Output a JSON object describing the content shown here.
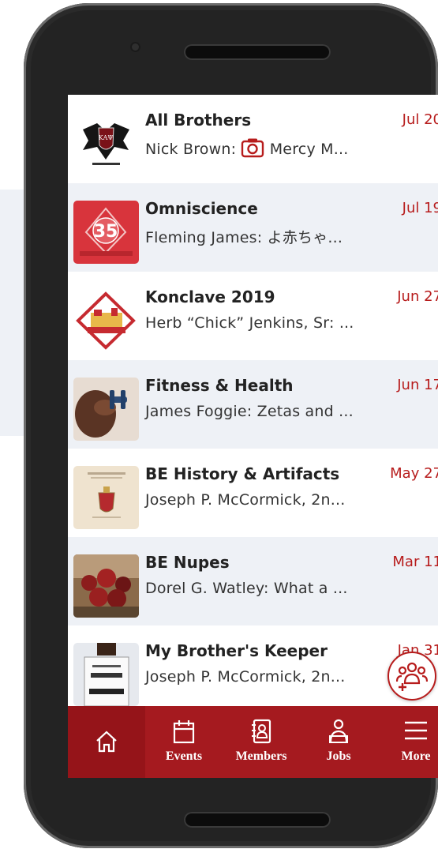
{
  "conversations": [
    {
      "title": "All Brothers",
      "date": "Jul 20",
      "sender": "Nick Brown:",
      "message": "Mercy M...",
      "attachment": "camera-icon",
      "thumb": "crest-logo"
    },
    {
      "title": "Omniscience",
      "date": "Jul 19",
      "sender": "Fleming James:",
      "message": "よ赤ちゃ...",
      "thumb": "omniscience-35-years"
    },
    {
      "title": "Konclave 2019",
      "date": "Jun 27",
      "sender": "Herb “Chick” Jenkins, Sr:",
      "message": "...",
      "thumb": "konclave-badge"
    },
    {
      "title": "Fitness & Health",
      "date": "Jun 17",
      "sender": "James Foggie:",
      "message": "Zetas and ...",
      "thumb": "dumbbell-photo"
    },
    {
      "title": "BE History & Artifacts",
      "date": "May 27",
      "sender": "Joseph P. McCormick, 2n...",
      "message": "",
      "thumb": "journal-cover"
    },
    {
      "title": "BE Nupes",
      "date": "Mar 11",
      "sender": "Dorel G. Watley:",
      "message": "What a ...",
      "thumb": "group-photo"
    },
    {
      "title": "My Brother's Keeper",
      "date": "Jan 31",
      "sender": "Joseph P. McCormick, 2n...",
      "message": "",
      "thumb": "support-sign-photo"
    }
  ],
  "tabs": [
    {
      "label": "",
      "icon": "home-icon"
    },
    {
      "label": "Events",
      "icon": "calendar-icon"
    },
    {
      "label": "Members",
      "icon": "contacts-icon"
    },
    {
      "label": "Jobs",
      "icon": "jobs-icon"
    },
    {
      "label": "More",
      "icon": "menu-icon"
    }
  ],
  "fab": {
    "icon": "new-group-icon"
  },
  "colors": {
    "accent": "#a51a1f",
    "date": "#b71c1c",
    "row_alt": "#eef1f6"
  }
}
